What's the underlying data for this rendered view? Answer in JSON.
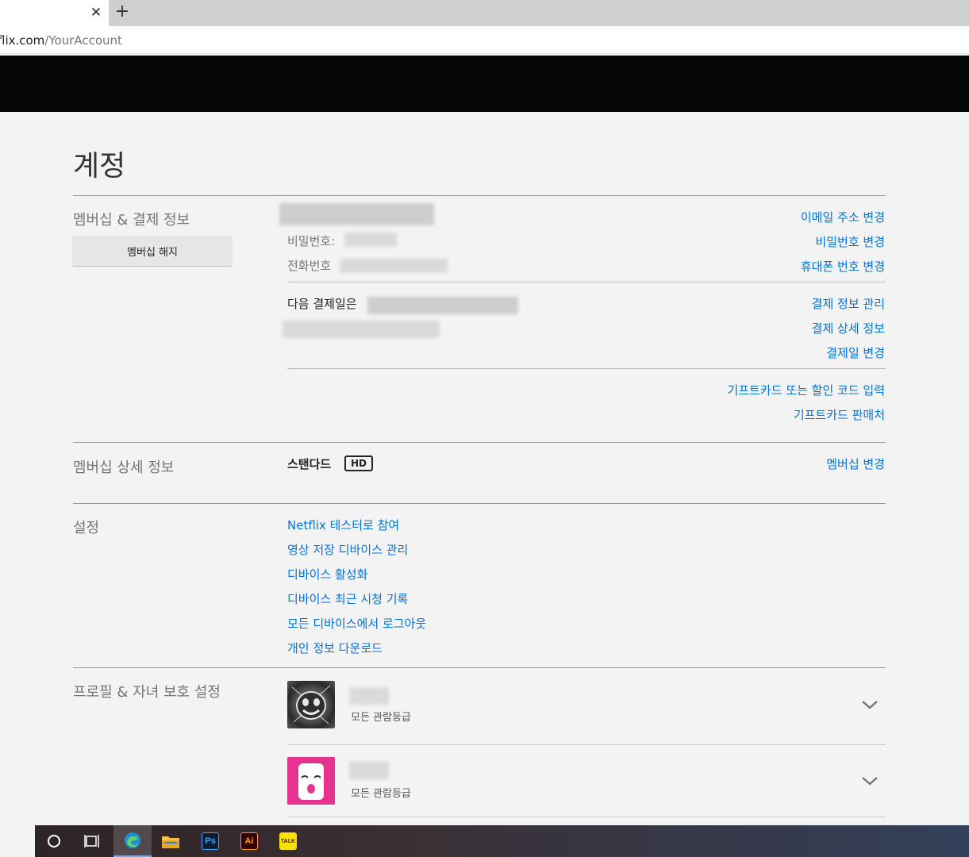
{
  "browser": {
    "url_host": "flix.com",
    "url_path": "/YourAccount",
    "new_tab": "+",
    "close": "✕"
  },
  "page": {
    "title": "계정"
  },
  "membership": {
    "section_title": "멤버십 & 결제 정보",
    "cancel_button": "멤버십 해지",
    "password_label": "비밀번호:",
    "phone_label": "전화번호",
    "next_billing_label": "다음 결제일은",
    "links": {
      "change_email": "이메일 주소 변경",
      "change_password": "비밀번호 변경",
      "change_phone": "휴대폰 번호 변경",
      "manage_payment": "결제 정보 관리",
      "billing_details": "결제 상세 정보",
      "change_billing_date": "결제일 변경",
      "redeem_gift": "기프트카드 또는 할인 코드 입력",
      "gift_retailers": "기프트카드 판매처"
    }
  },
  "plan": {
    "section_title": "멤버십 상세 정보",
    "name": "스탠다드",
    "badge": "HD",
    "change_link": "멤버십 변경"
  },
  "settings": {
    "section_title": "설정",
    "links": [
      "Netflix 테스터로 참여",
      "영상 저장 디바이스 관리",
      "디바이스 활성화",
      "디바이스 최근 시청 기록",
      "모든 디바이스에서 로그아웃",
      "개인 정보 다운로드"
    ]
  },
  "profiles": {
    "section_title": "프로필 & 자녀 보호 설정",
    "items": [
      {
        "rating": "모든 관람등급"
      },
      {
        "rating": "모든 관람등급"
      }
    ]
  },
  "taskbar": {
    "photoshop": "Ps",
    "illustrator": "Ai",
    "kakaotalk": "TALK"
  },
  "colors": {
    "link": "#0073e6",
    "background": "#f3f3f3",
    "header": "#050505"
  }
}
